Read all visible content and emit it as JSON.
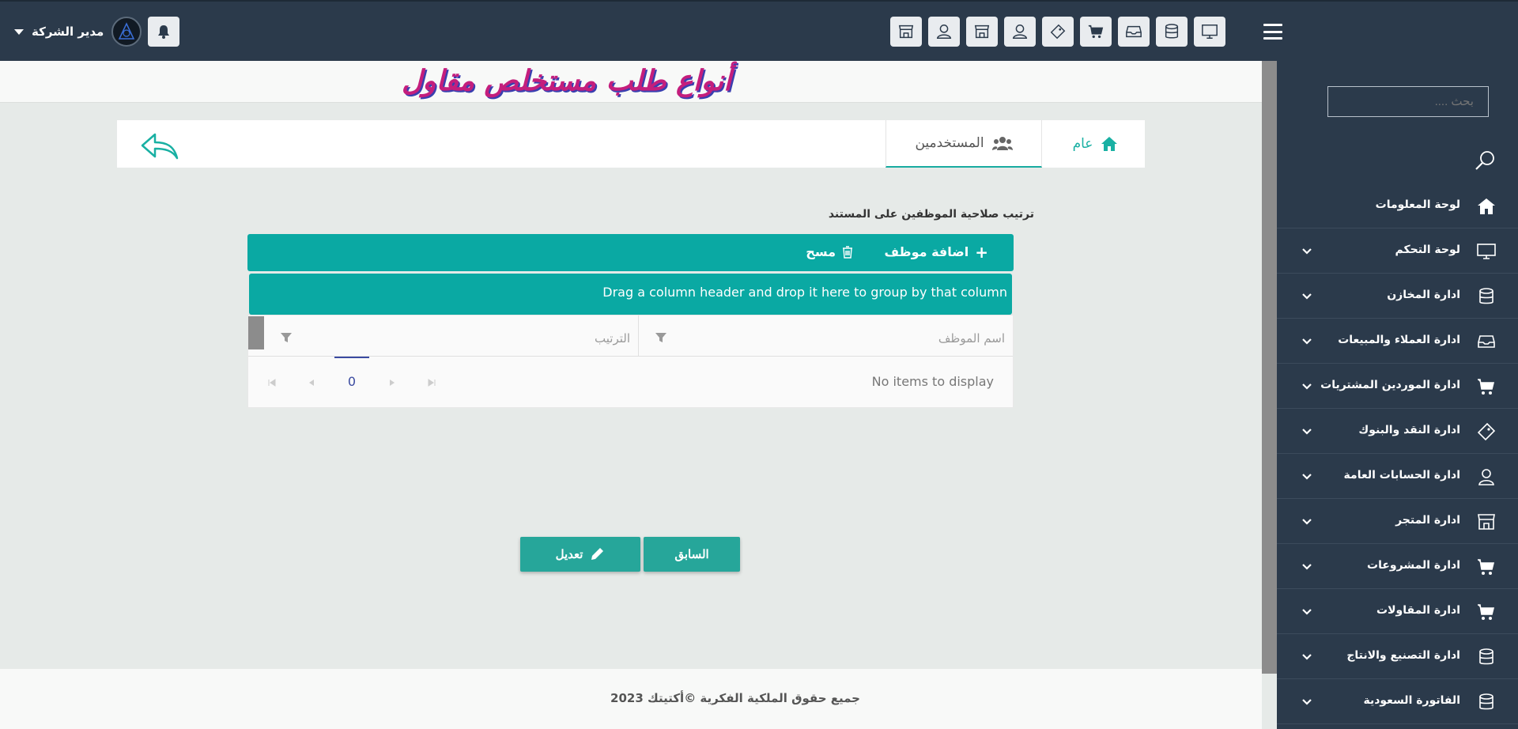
{
  "topbar": {
    "user_name": "مدير الشركة",
    "quick_icons": [
      "monitor-icon",
      "database-icon",
      "inbox-icon",
      "cart-icon",
      "ticket-icon",
      "user-icon",
      "store-icon",
      "user-icon",
      "store-icon"
    ]
  },
  "page": {
    "title": "أنواع طلب مستخلص مقاول"
  },
  "tabs": {
    "general": "عام",
    "users": "المستخدمين"
  },
  "section": {
    "title": "ترتيب صلاحية الموظفين على المستند"
  },
  "grid": {
    "add_label": "اضافة موظف",
    "delete_label": "مسح",
    "group_hint": "Drag a column header and drop it here to group by that column",
    "columns": [
      "اسم الموظف",
      "الترتيب"
    ],
    "empty_message": "No items to display",
    "current_page": "0"
  },
  "actions": {
    "prev_label": "السابق",
    "edit_label": "تعديل"
  },
  "sidebar": {
    "search_placeholder": "بحث ....",
    "items": [
      {
        "label": "لوحة المعلومات",
        "icon": "home-icon",
        "expandable": false
      },
      {
        "label": "لوحة التحكم",
        "icon": "monitor-icon",
        "expandable": true
      },
      {
        "label": "ادارة المخازن",
        "icon": "database-icon",
        "expandable": true
      },
      {
        "label": "ادارة العملاء والمبيعات",
        "icon": "inbox-icon",
        "expandable": true
      },
      {
        "label": "ادارة الموردين المشتريات",
        "icon": "cart-icon",
        "expandable": true
      },
      {
        "label": "ادارة النقد والبنوك",
        "icon": "ticket-icon",
        "expandable": true
      },
      {
        "label": "ادارة الحسابات العامة",
        "icon": "user-icon",
        "expandable": true
      },
      {
        "label": "ادارة المتجر",
        "icon": "store-icon",
        "expandable": true
      },
      {
        "label": "ادارة المشروعات",
        "icon": "cart-icon",
        "expandable": true
      },
      {
        "label": "ادارة المقاولات",
        "icon": "cart-icon",
        "expandable": true
      },
      {
        "label": "ادارة التصنيع والانتاج",
        "icon": "database-icon",
        "expandable": true
      },
      {
        "label": "الفاتورة السعودية",
        "icon": "database-icon",
        "expandable": true
      }
    ]
  },
  "footer": {
    "copyright": "جميع حقوق الملكية الفكرية ©أكتيتك 2023"
  },
  "colors": {
    "sidebar_bg": "#2b3a4b",
    "accent": "#0aa9a3",
    "button": "#26a69a"
  }
}
